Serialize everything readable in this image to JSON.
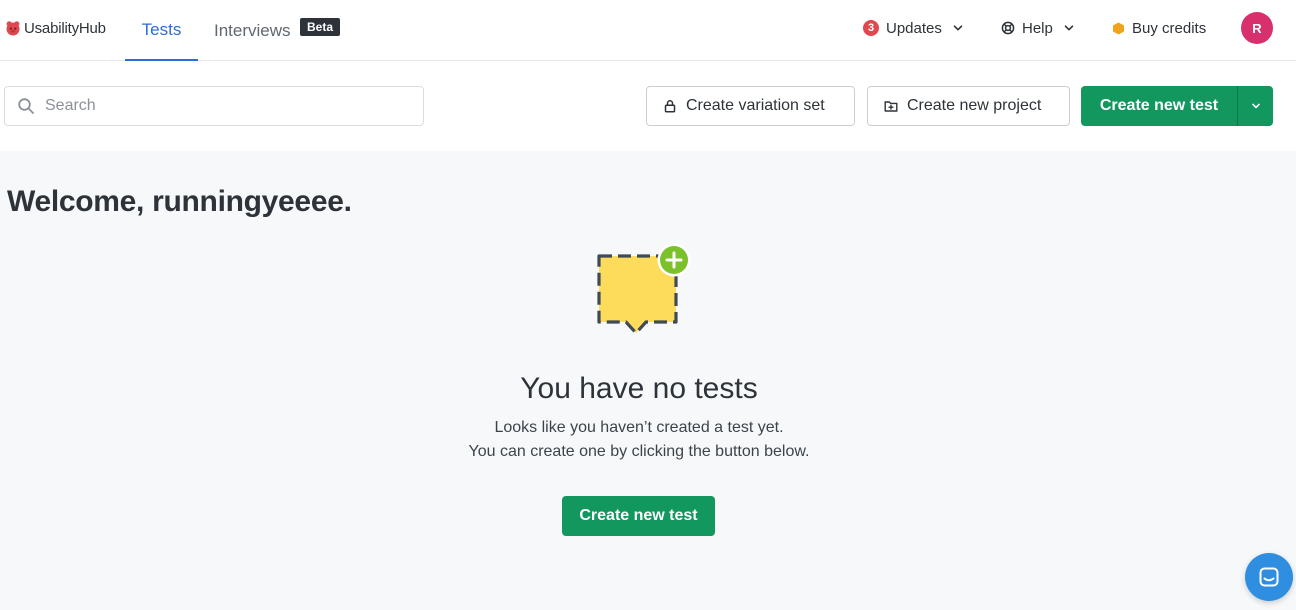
{
  "brand": {
    "name": "UsabilityHub",
    "logo_icon": "usabilityhub-logo-icon",
    "accent": "#2f6bd8",
    "primary_green": "#12975f"
  },
  "nav": {
    "tabs": [
      {
        "label": "Tests",
        "active": true
      },
      {
        "label": "Interviews",
        "active": false,
        "badge": "Beta"
      }
    ],
    "updates": {
      "count": "3",
      "label": "Updates"
    },
    "help": {
      "label": "Help"
    },
    "credits": {
      "label": "Buy credits"
    },
    "avatar": {
      "initial": "R",
      "color": "#d8306c"
    }
  },
  "toolbar": {
    "search": {
      "placeholder": "Search",
      "value": ""
    },
    "variation_button": "Create variation set",
    "project_button": "Create new project",
    "create_test_button": "Create new test"
  },
  "main": {
    "welcome": "Welcome, runningyeeee.",
    "empty_state": {
      "title": "You have no tests",
      "line1": "Looks like you haven’t created a test yet.",
      "line2": "You can create one by clicking the button below.",
      "cta": "Create new test"
    }
  },
  "chat_widget": {
    "icon": "chat-icon"
  }
}
